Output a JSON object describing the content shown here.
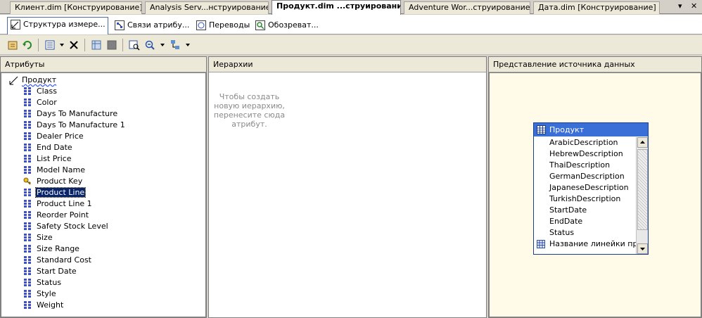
{
  "doc_tabs": [
    {
      "label": "Клиент.dim [Конструирование]"
    },
    {
      "label": "Analysis Serv...нструирование]"
    },
    {
      "label": "Продукт.dim ...струирование]"
    },
    {
      "label": "Adventure Wor...струирование]"
    },
    {
      "label": "Дата.dim [Конструирование]"
    }
  ],
  "window_controls": {
    "dropdown": "▾",
    "close": "✕"
  },
  "sub_tabs": [
    {
      "label": "Структура измере..."
    },
    {
      "label": "Связи атрибу..."
    },
    {
      "label": "Переводы"
    },
    {
      "label": "Обозреват..."
    }
  ],
  "panes": {
    "attributes": {
      "title": "Атрибуты"
    },
    "hierarchies": {
      "title": "Иерархии",
      "hint": "Чтобы создать\nновую иерархию,\nперенесите сюда\nатрибут."
    },
    "dsv": {
      "title": "Представление источника данных"
    }
  },
  "tree": {
    "root": "Продукт",
    "attributes": [
      {
        "label": "Class",
        "icon": "attribute-icon"
      },
      {
        "label": "Color",
        "icon": "attribute-icon"
      },
      {
        "label": "Days To Manufacture",
        "icon": "attribute-icon"
      },
      {
        "label": "Days To Manufacture 1",
        "icon": "attribute-icon"
      },
      {
        "label": "Dealer Price",
        "icon": "attribute-icon"
      },
      {
        "label": "End Date",
        "icon": "attribute-icon"
      },
      {
        "label": "List Price",
        "icon": "attribute-icon"
      },
      {
        "label": "Model Name",
        "icon": "attribute-icon"
      },
      {
        "label": "Product Key",
        "icon": "key-icon"
      },
      {
        "label": "Product Line",
        "icon": "attribute-icon",
        "selected": true
      },
      {
        "label": "Product Line 1",
        "icon": "attribute-icon"
      },
      {
        "label": "Reorder Point",
        "icon": "attribute-icon"
      },
      {
        "label": "Safety Stock Level",
        "icon": "attribute-icon"
      },
      {
        "label": "Size",
        "icon": "attribute-icon"
      },
      {
        "label": "Size Range",
        "icon": "attribute-icon"
      },
      {
        "label": "Standard Cost",
        "icon": "attribute-icon"
      },
      {
        "label": "Start Date",
        "icon": "attribute-icon"
      },
      {
        "label": "Status",
        "icon": "attribute-icon"
      },
      {
        "label": "Style",
        "icon": "attribute-icon"
      },
      {
        "label": "Weight",
        "icon": "attribute-icon"
      }
    ]
  },
  "dsv_table": {
    "title": "Продукт",
    "columns": [
      {
        "label": "ArabicDescription"
      },
      {
        "label": "HebrewDescription"
      },
      {
        "label": "ThaiDescription"
      },
      {
        "label": "GermanDescription"
      },
      {
        "label": "JapaneseDescription"
      },
      {
        "label": "TurkishDescription"
      },
      {
        "label": "StartDate"
      },
      {
        "label": "EndDate"
      },
      {
        "label": "Status"
      },
      {
        "label": "Название линейки пр...",
        "icon": "calculated-column-icon"
      }
    ]
  },
  "colors": {
    "selection": "#0a246a",
    "table_header": "#3b6fd8",
    "dsv_background": "#fffbe8"
  }
}
